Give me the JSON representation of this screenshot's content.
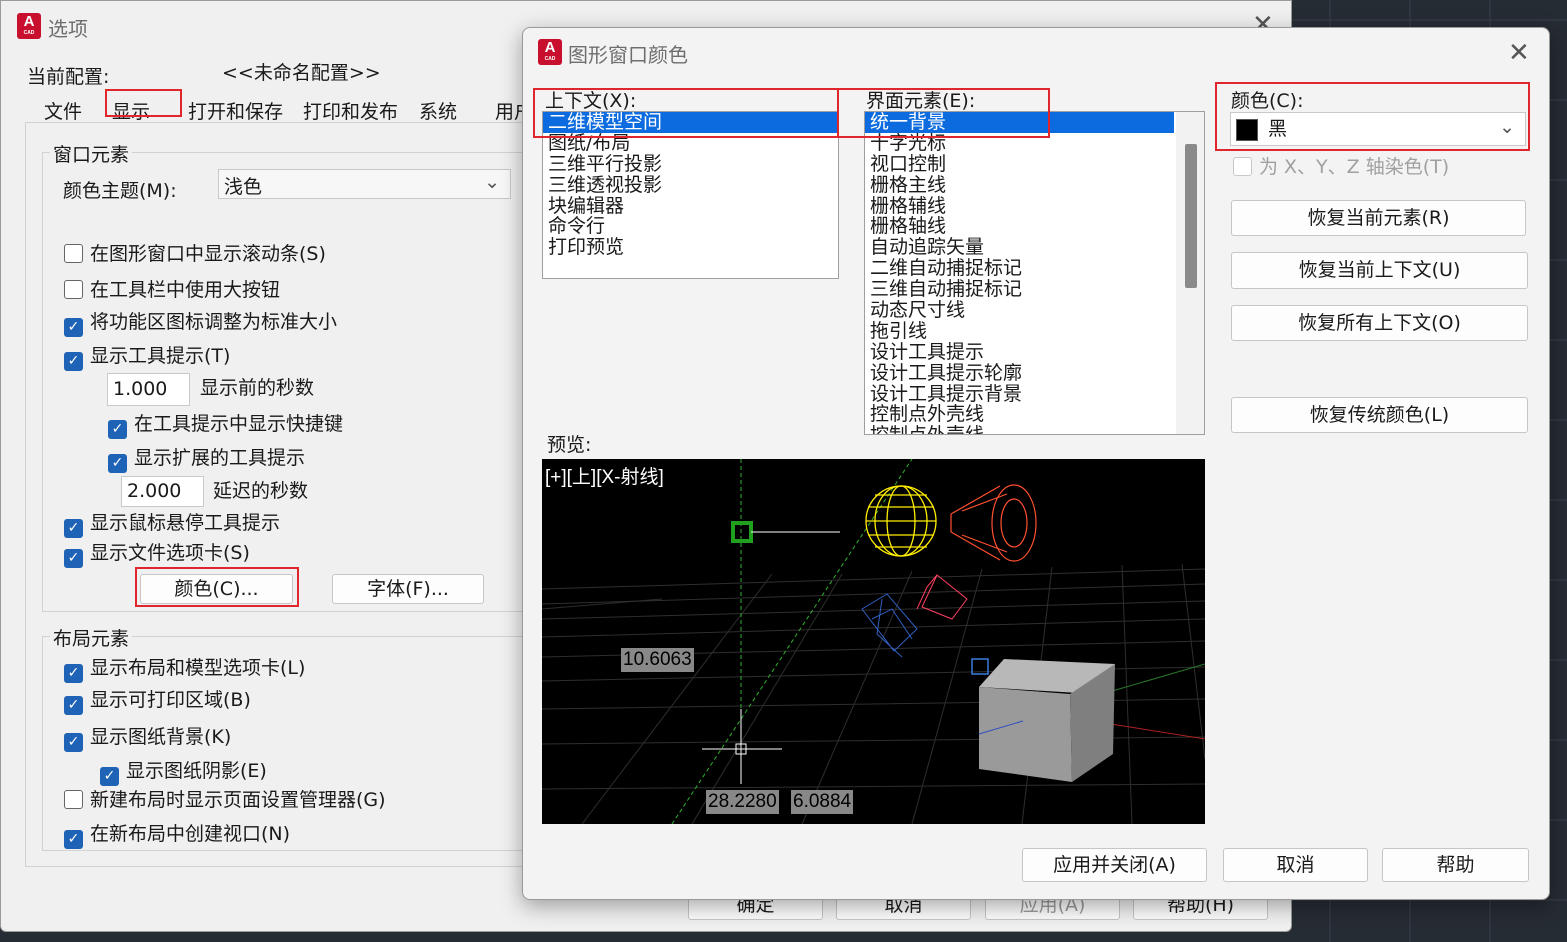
{
  "options_dialog": {
    "title": "选项",
    "profile_label": "当前配置:",
    "profile_value": "<<未命名配置>>",
    "tabs": [
      "文件",
      "显示",
      "打开和保存",
      "打印和发布",
      "系统",
      "用户"
    ],
    "window_elements": {
      "group_label": "窗口元素",
      "color_theme_label": "颜色主题(M):",
      "color_theme_value": "浅色",
      "scrollbars": "在图形窗口中显示滚动条(S)",
      "large_buttons": "在工具栏中使用大按钮",
      "resize_ribbon_icons": "将功能区图标调整为标准大小",
      "show_tooltips": "显示工具提示(T)",
      "tooltip_delay_value": "1.000",
      "tooltip_delay_label": "显示前的秒数",
      "shortcut_keys": "在工具提示中显示快捷键",
      "extended_tooltips": "显示扩展的工具提示",
      "extended_delay_value": "2.000",
      "extended_delay_label": "延迟的秒数",
      "rollover_tooltips": "显示鼠标悬停工具提示",
      "file_tabs": "显示文件选项卡(S)",
      "colors_button": "颜色(C)...",
      "fonts_button": "字体(F)..."
    },
    "layout_elements": {
      "group_label": "布局元素",
      "layout_model_tabs": "显示布局和模型选项卡(L)",
      "printable_area": "显示可打印区域(B)",
      "paper_background": "显示图纸背景(K)",
      "paper_shadow": "显示图纸阴影(E)",
      "page_setup_manager": "新建布局时显示页面设置管理器(G)",
      "create_viewport": "在新布局中创建视口(N)"
    },
    "footer_buttons": [
      "确定",
      "取消",
      "应用(A)",
      "帮助(H)"
    ]
  },
  "color_dialog": {
    "title": "图形窗口颜色",
    "context_label": "上下文(X):",
    "contexts": [
      "二维模型空间",
      "图纸/布局",
      "三维平行投影",
      "三维透视投影",
      "块编辑器",
      "命令行",
      "打印预览"
    ],
    "selected_context": "二维模型空间",
    "element_label": "界面元素(E):",
    "elements": [
      "统一背景",
      "十字光标",
      "视口控制",
      "栅格主线",
      "栅格辅线",
      "栅格轴线",
      "自动追踪矢量",
      "二维自动捕捉标记",
      "三维自动捕捉标记",
      "动态尺寸线",
      "拖引线",
      "设计工具提示",
      "设计工具提示轮廓",
      "设计工具提示背景",
      "控制点外壳线",
      "控制点外壳线"
    ],
    "selected_element": "统一背景",
    "color_label": "颜色(C):",
    "color_value": "黑",
    "color_swatch": "#000000",
    "tint_xyz": "为 X、Y、Z 轴染色(T)",
    "restore_element": "恢复当前元素(R)",
    "restore_context": "恢复当前上下文(U)",
    "restore_all": "恢复所有上下文(O)",
    "restore_classic": "恢复传统颜色(L)",
    "preview_label": "预览:",
    "preview": {
      "viewport_label": "[+][上][X-射线]",
      "dim_value_1": "10.6063",
      "dim_value_2": "28.2280",
      "dim_value_3": "6.0884"
    },
    "apply_close": "应用并关闭(A)",
    "cancel": "取消",
    "help": "帮助"
  },
  "colors": {
    "highlight": "#e0262b",
    "selection": "#0c6bde",
    "checkbox": "#1f63b6",
    "brand": "#c8102e"
  }
}
